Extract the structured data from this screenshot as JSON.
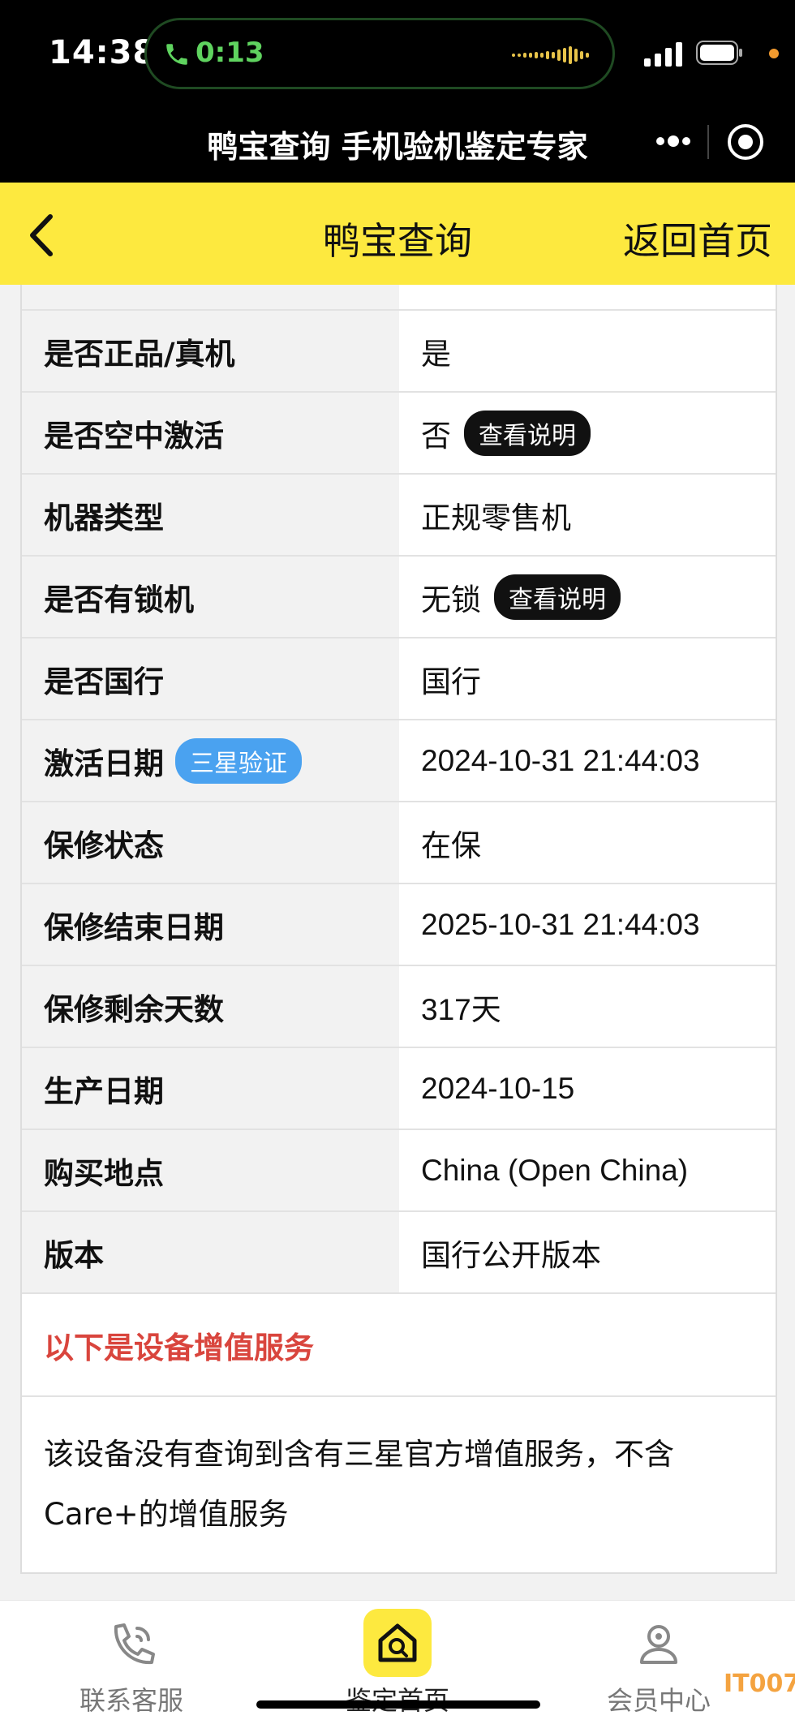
{
  "status_bar": {
    "time": "14:38",
    "call_time": "0:13",
    "icons": [
      "phone-icon",
      "audio-wave-icon",
      "signal-icon",
      "battery-icon"
    ]
  },
  "mini_program": {
    "title": "鸭宝查询 手机验机鉴定专家",
    "icons": [
      "more-icon",
      "close-target-icon"
    ]
  },
  "nav": {
    "title": "鸭宝查询",
    "home_label": "返回首页",
    "accent": "#fde93f"
  },
  "rows": [
    {
      "label": "是否正品/真机",
      "value": "是"
    },
    {
      "label": "是否空中激活",
      "value": "否",
      "action": "查看说明"
    },
    {
      "label": "机器类型",
      "value": "正规零售机"
    },
    {
      "label": "是否有锁机",
      "value": "无锁",
      "action": "查看说明"
    },
    {
      "label": "是否国行",
      "value": "国行"
    },
    {
      "label": "激活日期",
      "badge": "三星验证",
      "value": "2024-10-31 21:44:03"
    },
    {
      "label": "保修状态",
      "value": "在保"
    },
    {
      "label": "保修结束日期",
      "value": "2025-10-31 21:44:03"
    },
    {
      "label": "保修剩余天数",
      "value": "317天"
    },
    {
      "label": "生产日期",
      "value": "2024-10-15"
    },
    {
      "label": "购买地点",
      "value": "China (Open China)"
    },
    {
      "label": "版本",
      "value": "国行公开版本"
    }
  ],
  "section_title": "以下是设备增值服务",
  "service_note": "该设备没有查询到含有三星官方增值服务，不含Care+的增值服务",
  "tabs": [
    {
      "label": "联系客服",
      "icon": "phone-support-icon"
    },
    {
      "label": "鉴定首页",
      "icon": "home-search-icon"
    },
    {
      "label": "会员中心",
      "icon": "user-icon"
    }
  ],
  "watermark": "IT007"
}
